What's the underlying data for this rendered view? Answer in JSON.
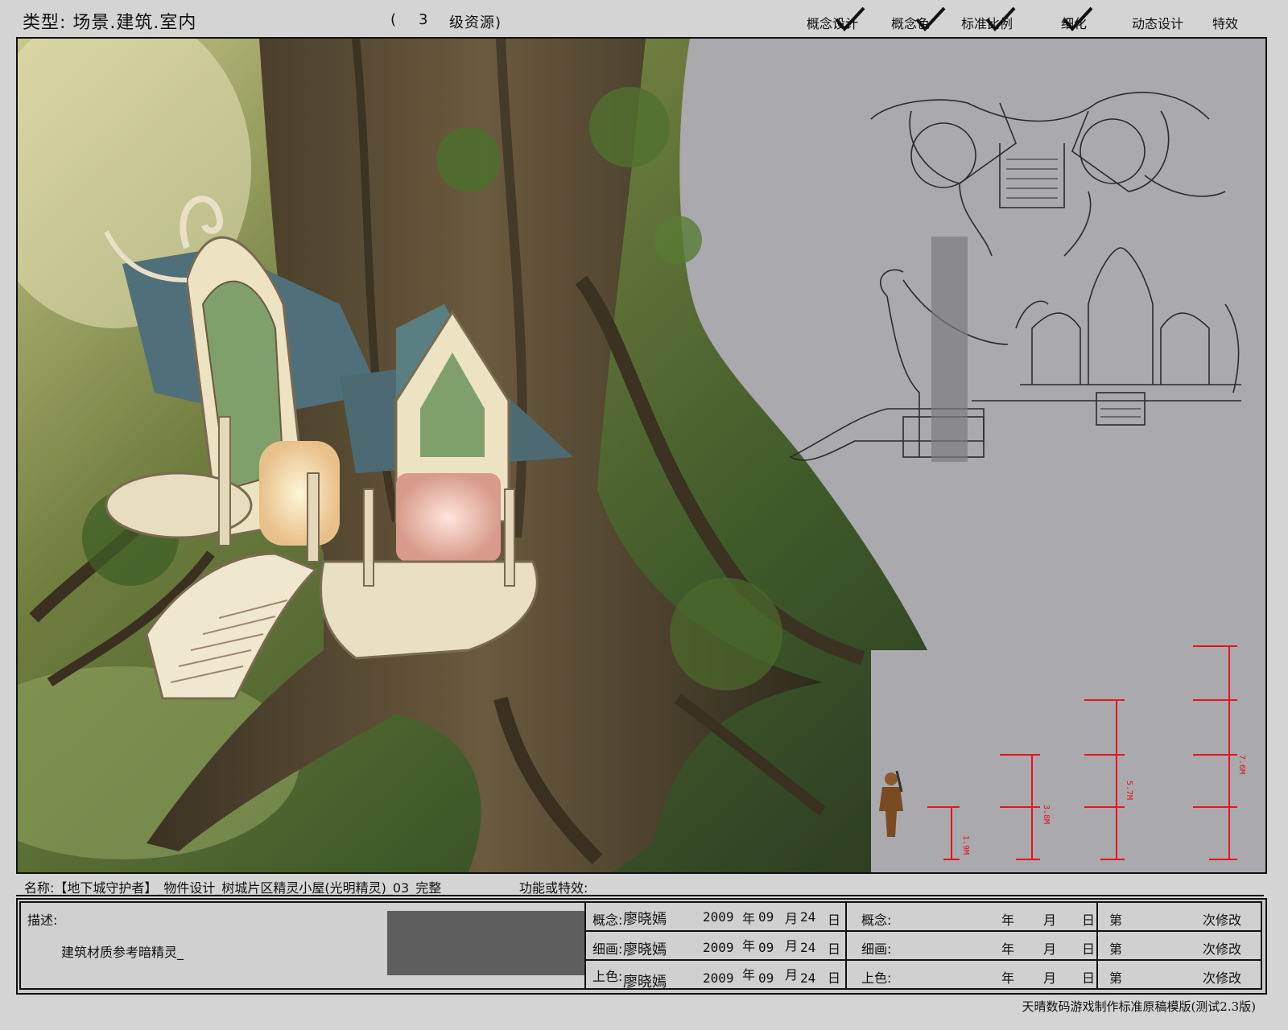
{
  "header": {
    "category_label": "类型: 场景.建筑.室内",
    "resource_open": "(",
    "resource_level": "3",
    "resource_label": "级资源)",
    "stages": [
      {
        "label": "概念设计",
        "checked": true
      },
      {
        "label": "概念色",
        "checked": true
      },
      {
        "label": "标准比例",
        "checked": true
      },
      {
        "label": "细化",
        "checked": true
      },
      {
        "label": "动态设计",
        "checked": false
      },
      {
        "label": "特效",
        "checked": false
      }
    ]
  },
  "scale": {
    "markers": [
      "1.9M",
      "3.8M",
      "5.7M",
      "7.6M"
    ]
  },
  "info": {
    "name_line": "名称:【地下城守护者】_物件设计_树城片区精灵小屋(光明精灵)_03_完整",
    "function_label": "功能或特效:",
    "description_label": "描述:",
    "description_text": "建筑材质参考暗精灵_",
    "credits": [
      {
        "role": "概念:",
        "artist": "廖晓嫣",
        "year": "2009",
        "month": "09",
        "day": "24"
      },
      {
        "role": "细画:",
        "artist": "廖晓嫣",
        "year": "2009",
        "month": "09",
        "day": "24"
      },
      {
        "role": "上色:",
        "artist": "廖晓嫣",
        "year": "2009",
        "month": "09",
        "day": "24"
      }
    ],
    "unit_year": "年",
    "unit_month": "月",
    "unit_day": "日",
    "revision_rows": [
      {
        "role": "概念:"
      },
      {
        "role": "细画:"
      },
      {
        "role": "上色:"
      }
    ],
    "revision_prefix": "第",
    "revision_suffix": "次修改"
  },
  "footer": "天晴数码游戏制作标准原稿模版(测试2.3版)",
  "colors": {
    "scale_red": "#e8141e",
    "sheet_grey": "#a9a9ae",
    "redacted_box": "#5e5e5e"
  }
}
